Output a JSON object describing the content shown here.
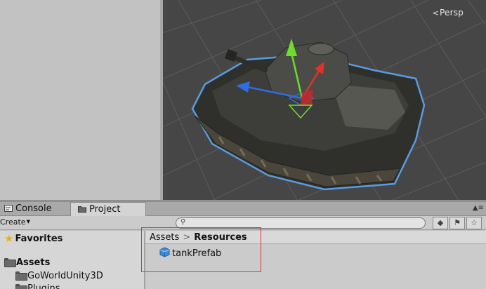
{
  "scene": {
    "view_label": "Persp",
    "persp_icon": "persp-gizmo-icon",
    "colors": {
      "background": "#464646",
      "grid": "#6a6a6a",
      "axis_y": "#6fdc2c",
      "axis_x": "#e0332a",
      "axis_z": "#2f6de0",
      "outline": "#5a9be0"
    }
  },
  "tabs": [
    {
      "label": "Console",
      "icon": "console-icon"
    },
    {
      "label": "Project",
      "icon": "folder-icon"
    }
  ],
  "toolbar": {
    "create_label": "Create",
    "search_placeholder": "",
    "buttons": [
      "search-by-type-icon",
      "search-by-label-icon",
      "favorite-star-icon"
    ]
  },
  "sidebar": {
    "favorites_label": "Favorites",
    "assets_label": "Assets",
    "items": [
      {
        "label": "GoWorldUnity3D"
      },
      {
        "label": "Plugins"
      }
    ]
  },
  "breadcrumb": {
    "root": "Assets",
    "separator": ">",
    "current": "Resources"
  },
  "assets": [
    {
      "name": "tankPrefab",
      "icon": "prefab-cube-icon"
    }
  ],
  "annotation": {
    "color": "#e23232"
  }
}
